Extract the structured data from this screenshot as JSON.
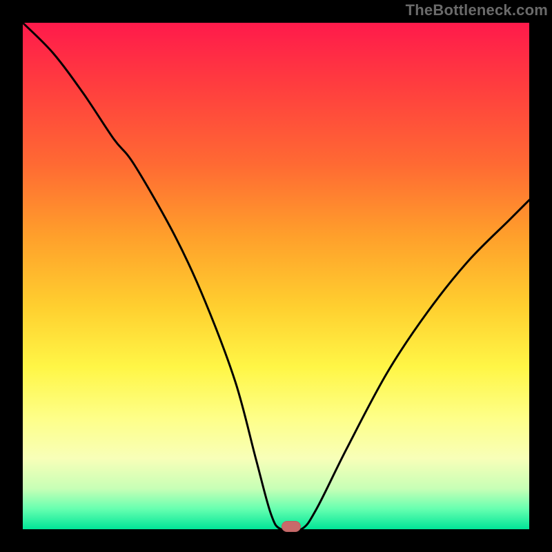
{
  "watermark": "TheBottleneck.com",
  "chart_data": {
    "type": "line",
    "title": "",
    "xlabel": "",
    "ylabel": "",
    "xlim": [
      0,
      100
    ],
    "ylim": [
      0,
      100
    ],
    "grid": false,
    "legend": false,
    "background_gradient": {
      "orientation": "vertical",
      "stops": [
        {
          "pct": 0,
          "color": "#ff1a4b"
        },
        {
          "pct": 28,
          "color": "#ff6a33"
        },
        {
          "pct": 56,
          "color": "#ffcf2f"
        },
        {
          "pct": 78,
          "color": "#feff88"
        },
        {
          "pct": 96,
          "color": "#66ffb0"
        },
        {
          "pct": 100,
          "color": "#00e597"
        }
      ]
    },
    "series": [
      {
        "name": "bottleneck-curve",
        "x": [
          0,
          6,
          12,
          18,
          22,
          30,
          36,
          42,
          46,
          49,
          51,
          55,
          58,
          64,
          72,
          80,
          88,
          96,
          100
        ],
        "y": [
          100,
          94,
          86,
          77,
          72,
          58,
          45,
          29,
          14,
          3,
          0,
          0,
          4,
          16,
          31,
          43,
          53,
          61,
          65
        ]
      }
    ],
    "marker": {
      "name": "optimal-point",
      "x_pct": 53,
      "y_pct": 0,
      "color": "#c86a6a",
      "shape": "pill"
    }
  }
}
